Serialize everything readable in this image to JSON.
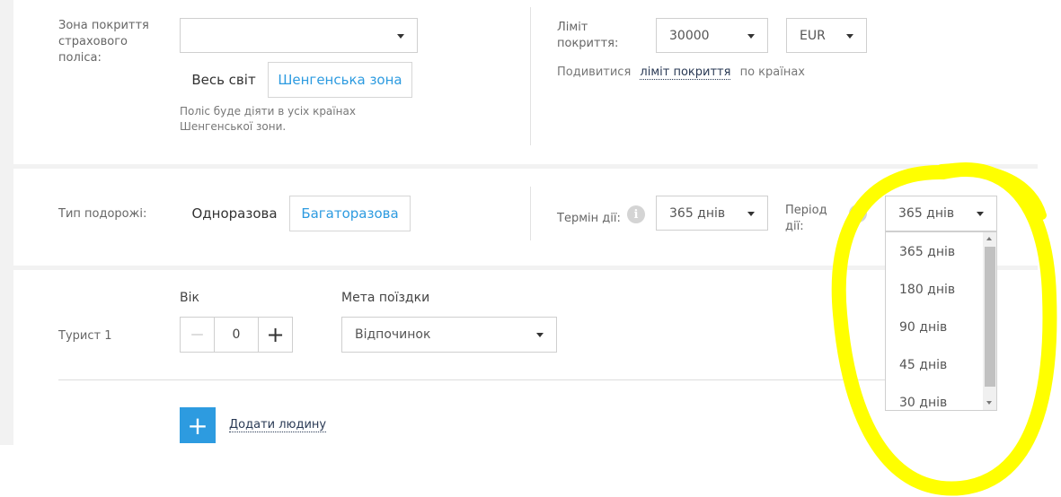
{
  "coverage": {
    "zone_label": "Зона покриття страхового поліса:",
    "zone_select_value": "",
    "zone_options": [
      "Весь світ",
      "Шенгенська зона"
    ],
    "zone_hint": "Поліс буде діяти в усіх країнах Шенгенської зони.",
    "limit_label": "Ліміт покриття:",
    "limit_value": "30000",
    "currency_value": "EUR",
    "view_text": "Подивитися",
    "view_link": "ліміт покриття",
    "view_suffix": "по країнах"
  },
  "trip": {
    "type_label": "Тип подорожі:",
    "type_options": [
      "Одноразова",
      "Багаторазова"
    ],
    "term_label": "Термін дії:",
    "term_value": "365 днів",
    "period_label": "Період дії:",
    "period_value": "365 днів",
    "period_options": [
      "365 днів",
      "180 днів",
      "90 днів",
      "45 днів",
      "30 днів"
    ]
  },
  "tourist": {
    "name": "Турист 1",
    "age_label": "Вік",
    "age_value": "0",
    "minus_symbol": "—",
    "plus_symbol": "+",
    "purpose_label": "Мета поїздки",
    "purpose_value": "Відпочинок"
  },
  "add_person": {
    "icon_symbol": "+",
    "label": "Додати людину"
  },
  "colors": {
    "accent": "#2d9be0",
    "highlight": "#ffff00"
  }
}
